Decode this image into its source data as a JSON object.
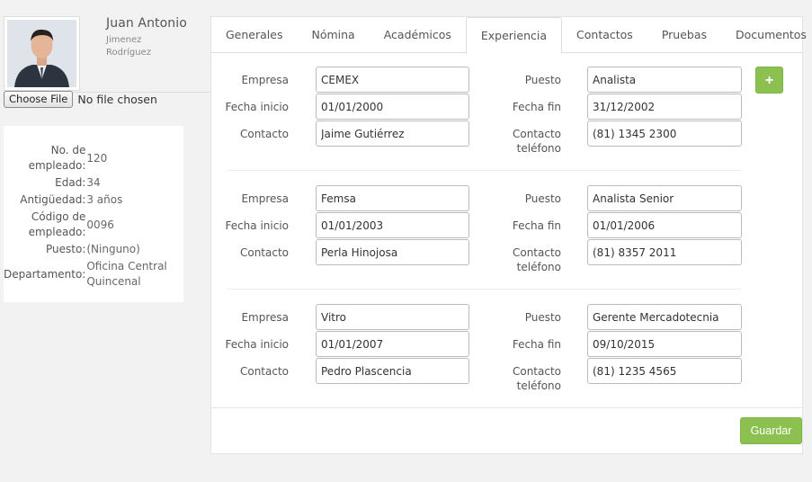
{
  "profile": {
    "name": "Juan Antonio",
    "surname1": "Jimenez",
    "surname2": "Rodríguez",
    "photo_icon": "person-photo"
  },
  "file_input": {
    "button_label": "Choose File",
    "status": "No file chosen"
  },
  "employee_info": [
    {
      "label": "No. de empleado:",
      "value": "120"
    },
    {
      "label": "Edad:",
      "value": "34"
    },
    {
      "label": "Antigüedad:",
      "value": "3 años"
    },
    {
      "label": "Código de empleado:",
      "value": "0096"
    },
    {
      "label": "Puesto:",
      "value": "(Ninguno)"
    },
    {
      "label": "Departamento:",
      "value": "Oficina Central Quincenal"
    }
  ],
  "tabs": [
    {
      "label": "Generales",
      "active": false
    },
    {
      "label": "Nómina",
      "active": false
    },
    {
      "label": "Académicos",
      "active": false
    },
    {
      "label": "Experiencia",
      "active": true
    },
    {
      "label": "Contactos",
      "active": false
    },
    {
      "label": "Pruebas",
      "active": false
    },
    {
      "label": "Documentos",
      "active": false
    }
  ],
  "labels": {
    "empresa": "Empresa",
    "fecha_inicio": "Fecha inicio",
    "contacto": "Contacto",
    "puesto": "Puesto",
    "fecha_fin": "Fecha fin",
    "contacto_telefono_1": "Contacto",
    "contacto_telefono_2": "teléfono"
  },
  "experience": [
    {
      "empresa": "CEMEX",
      "fecha_inicio": "01/01/2000",
      "contacto": "Jaime Gutiérrez",
      "puesto": "Analista",
      "fecha_fin": "31/12/2002",
      "telefono": "(81) 1345 2300"
    },
    {
      "empresa": "Femsa",
      "fecha_inicio": "01/01/2003",
      "contacto": "Perla Hinojosa",
      "puesto": "Analista Senior",
      "fecha_fin": "01/01/2006",
      "telefono": "(81) 8357 2011"
    },
    {
      "empresa": "Vitro",
      "fecha_inicio": "01/01/2007",
      "contacto": "Pedro Plascencia",
      "puesto": "Gerente Mercadotecnia",
      "fecha_fin": "09/10/2015",
      "telefono": "(81) 1235 4565"
    }
  ],
  "add_button": {
    "label": "+",
    "icon": "plus-icon"
  },
  "save_button": {
    "label": "Guardar"
  },
  "colors": {
    "accent": "#8cc152",
    "background": "#f2f2f2"
  }
}
